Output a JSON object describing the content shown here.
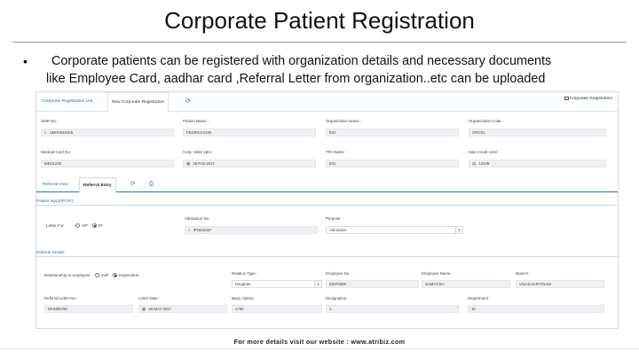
{
  "slide": {
    "title": "Corporate Patient Registration",
    "bullet": "•",
    "bullet_line1": "Corporate patients can be registered  with organization details and necessary documents",
    "bullet_line2": "like Employee Card, aadhar card ,Referral Letter from organization..etc can be uploaded",
    "footer": "For more details visit our website : www.atribiz.com"
  },
  "app": {
    "tabs": [
      "Corporate Registration List",
      "New Corporate Registration"
    ],
    "refresh_icon": "refresh-icon",
    "header_label": "Corporate Registration",
    "row1": {
      "umr_label": "UMR No:",
      "umr_value": "UMR0045465",
      "patient_label": "Patient Name :",
      "patient_value": "FEDRICKSON",
      "org_label": "Organization Name :",
      "org_value": "ESI",
      "orgcode_label": "Organization Code :",
      "orgcode_value": "ORG01"
    },
    "row2": {
      "medcard_label": "Medical Card No:",
      "medcard_value": "MED1232",
      "valid_label": "Corp. Valid Upto:",
      "valid_value": "28-Feb-2017",
      "tpa_label": "TPA Name :",
      "tpa_value": "ESI",
      "maxcredit_label": "Max Credit Limit:",
      "maxcredit_value": "12345"
    },
    "subtabs": [
      "Referral View",
      "Referral Entry"
    ],
    "patient_input_heading": "Patient Input(IP/OP) :",
    "letter_for_label": "Letter For",
    "letter_options": [
      "OP",
      "IP"
    ],
    "letter_selected": "IP",
    "admission_label": "Admission No :",
    "admission_value": "IP1604337",
    "purpose_label": "Purpose :",
    "purpose_value": "Admission",
    "referral_details_heading": "Referral Details",
    "relationship_label": "Relationship to employee",
    "relationship_options": [
      "Self",
      "Dependent"
    ],
    "relationship_selected": "Dependent",
    "relation_type_label": "Relation Type:",
    "relation_type_value": "Daughter",
    "employee_no_label": "Employee No. :",
    "employee_no_value": "EMP3069",
    "employee_name_label": "Employee Name:",
    "employee_name_value": "SAMYOSH",
    "branch_label": "Branch :",
    "branch_value": "VISAKHAPATNAM",
    "ref_letter_no_label": "Referral Letter No:",
    "ref_letter_no_value": "MHN09765",
    "letter_date_label": "Letter Date:",
    "letter_date_value": "26-MAY-2017",
    "basic_salary_label": "Basic Salary:",
    "basic_salary_value": "1780",
    "designation_label": "Designation :",
    "designation_value": "1",
    "department_label": "Department :",
    "department_value": "10"
  },
  "colors": {
    "accent": "#2f6db5",
    "field_bg": "#eef0f3"
  }
}
